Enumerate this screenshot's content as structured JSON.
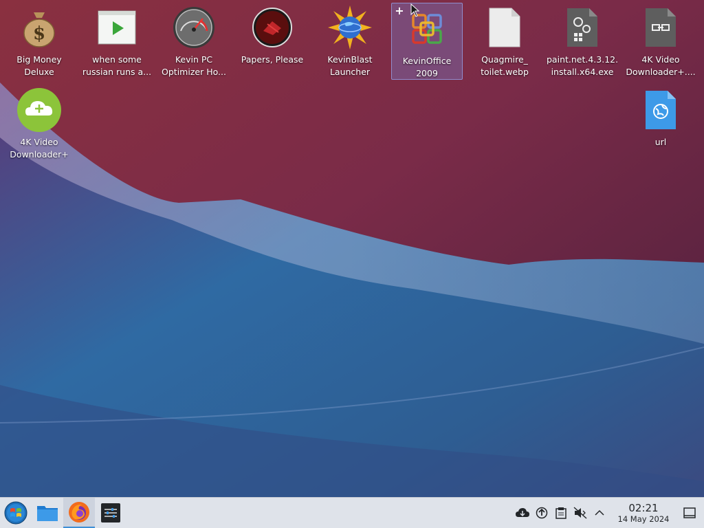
{
  "desktop": {
    "icons": [
      {
        "label": "Big Money Deluxe",
        "icon": "money-bag-icon"
      },
      {
        "label": "when some russian runs a...",
        "icon": "video-play-icon"
      },
      {
        "label": "Kevin PC Optimizer Ho...",
        "icon": "speedometer-icon"
      },
      {
        "label": "Papers, Please",
        "icon": "papers-please-icon"
      },
      {
        "label": "KevinBlast Launcher",
        "icon": "globe-star-icon"
      },
      {
        "label": "KevinOffice 2009",
        "icon": "office-logo-icon",
        "selected": true
      },
      {
        "label": "Quagmire_ toilet.webp",
        "icon": "image-file-icon"
      },
      {
        "label": "paint.net.4.3.12. install.x64.exe",
        "icon": "executable-file-icon"
      },
      {
        "label": "4K Video Downloader+....",
        "icon": "shortcut-file-icon"
      },
      {
        "label": "4K Video Downloader+",
        "icon": "cloud-download-icon"
      },
      {
        "label": "url",
        "icon": "url-file-icon"
      }
    ]
  },
  "taskbar": {
    "launchers": [
      {
        "name": "start-menu",
        "icon": "windows-logo-icon"
      },
      {
        "name": "file-manager",
        "icon": "folder-icon"
      },
      {
        "name": "firefox",
        "icon": "firefox-icon",
        "active": true
      },
      {
        "name": "settings",
        "icon": "mixer-icon"
      }
    ],
    "tray": [
      "cloud-icon",
      "update-icon",
      "clipboard-icon",
      "volume-muted-icon",
      "chevron-up-icon"
    ],
    "clock": {
      "time": "02:21",
      "date": "14 May 2024"
    }
  },
  "colors": {
    "selection": "#7a6fb8",
    "taskbar_bg": "#dfe3ea",
    "accent": "#3d8fd6"
  }
}
